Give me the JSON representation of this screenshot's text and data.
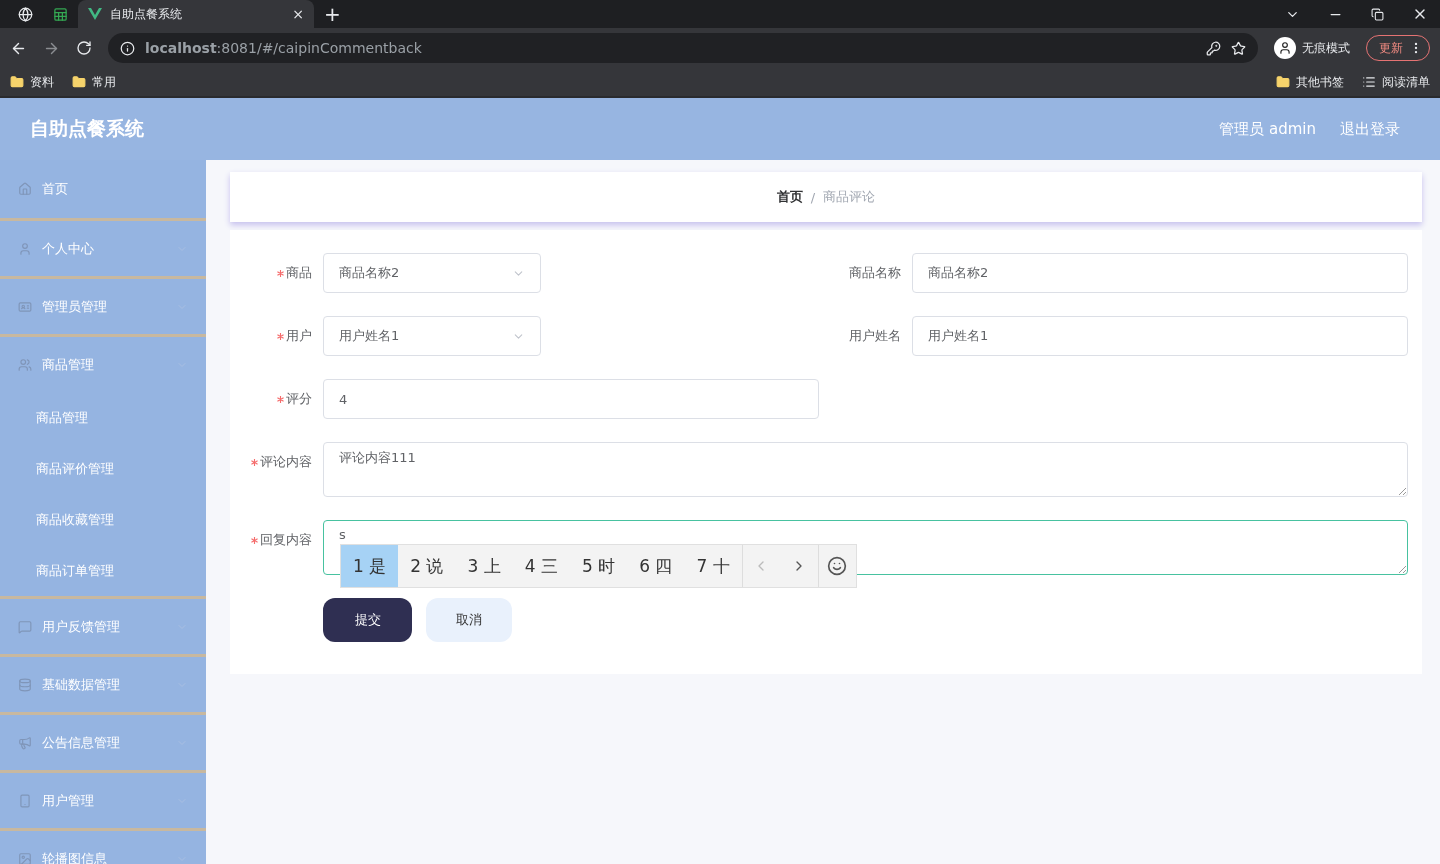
{
  "browser": {
    "tabs": [
      {
        "kind": "pinned",
        "selected": false
      },
      {
        "kind": "pinned",
        "selected": false
      },
      {
        "kind": "page",
        "title": "自助点餐系统",
        "close": "×",
        "selected": true
      }
    ],
    "new_tab": "+",
    "url": "**localhost**:8081/#/caipinCommentback",
    "profile": "无痕模式",
    "update": "更新",
    "bookmarks": [
      "资料",
      "常用"
    ],
    "bookmarks_right": [
      "其他书签",
      "阅读清单"
    ]
  },
  "header": {
    "title": "自助点餐系统",
    "user": "管理员 admin",
    "logout": "退出登录"
  },
  "sidebar": {
    "items": [
      {
        "label": "首页"
      },
      {
        "label": "个人中心"
      },
      {
        "label": "管理员管理"
      },
      {
        "label": "商品管理",
        "children": [
          {
            "label": "商品管理"
          },
          {
            "label": "商品评价管理"
          },
          {
            "label": "商品收藏管理"
          },
          {
            "label": "商品订单管理"
          }
        ]
      },
      {
        "label": "用户反馈管理"
      },
      {
        "label": "基础数据管理"
      },
      {
        "label": "公告信息管理"
      },
      {
        "label": "用户管理"
      },
      {
        "label": "轮播图信息"
      }
    ]
  },
  "breadcrumb": {
    "items": [
      "首页",
      "商品评论"
    ],
    "separator": "/"
  },
  "form": {
    "rows": [
      [
        {
          "label": "商品",
          "required": true,
          "kind": "select",
          "value": "商品名称2"
        },
        {
          "label": "商品名称",
          "kind": "input",
          "value": "商品名称2"
        }
      ],
      [
        {
          "label": "用户",
          "required": true,
          "kind": "select",
          "value": "用户姓名1"
        },
        {
          "label": "用户姓名",
          "kind": "input",
          "value": "用户姓名1"
        }
      ],
      [
        {
          "label": "评分",
          "required": true,
          "kind": "input",
          "value": "4"
        }
      ],
      [
        {
          "label": "评论内容",
          "required": true,
          "kind": "textarea",
          "value": "评论内容111",
          "focused": false
        }
      ],
      [
        {
          "label": "回复内容",
          "required": true,
          "kind": "textarea",
          "value": "s",
          "focused": true
        }
      ]
    ],
    "buttons": [
      {
        "label": "提交",
        "kind": "primary"
      },
      {
        "label": "取消",
        "kind": "secondary"
      }
    ]
  },
  "ime": {
    "candidates": [
      {
        "label": "1 是",
        "selected": true
      },
      {
        "label": "2 说",
        "selected": false
      },
      {
        "label": "3 上",
        "selected": false
      },
      {
        "label": "4 三",
        "selected": false
      },
      {
        "label": "5 时",
        "selected": false
      },
      {
        "label": "6 四",
        "selected": false
      },
      {
        "label": "7 十",
        "selected": false
      }
    ]
  }
}
